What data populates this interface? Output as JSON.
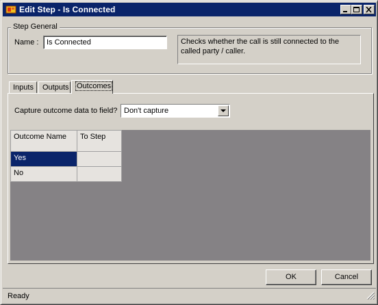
{
  "window": {
    "title": "Edit Step - Is Connected"
  },
  "step_general": {
    "legend": "Step General",
    "name_label": "Name :",
    "name_value": "Is Connected",
    "description": "Checks whether the call is still connected to the called party / caller."
  },
  "tabs": [
    {
      "label": "Inputs",
      "selected": false
    },
    {
      "label": "Outputs",
      "selected": false
    },
    {
      "label": "Outcomes",
      "selected": true
    }
  ],
  "outcomes": {
    "capture_label": "Capture outcome data to field?",
    "capture_value": "Don't capture",
    "columns": [
      "Outcome Name",
      "To Step"
    ],
    "rows": [
      {
        "outcome": "Yes",
        "to_step": "",
        "selected": true
      },
      {
        "outcome": "No",
        "to_step": "",
        "selected": false
      }
    ]
  },
  "buttons": {
    "ok": "OK",
    "cancel": "Cancel"
  },
  "status": {
    "text": "Ready"
  },
  "icons": {
    "title": "app-icon",
    "minimize": "minimize-icon",
    "maximize": "maximize-icon",
    "close": "close-icon",
    "dropdown": "chevron-down-icon",
    "grip": "resize-grip-icon"
  },
  "colors": {
    "titlebar": "#0a246a",
    "face": "#d4d0c8",
    "grid_bg": "#858285",
    "selection": "#0a246a"
  }
}
